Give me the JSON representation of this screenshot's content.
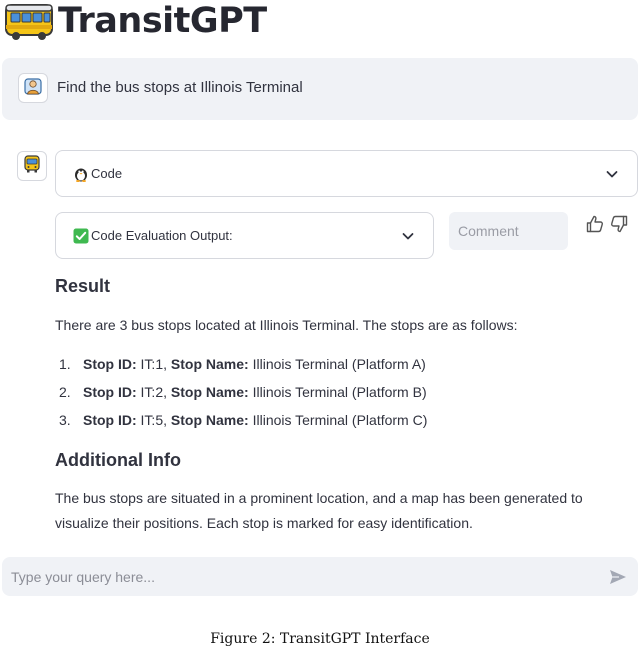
{
  "app": {
    "title": "TransitGPT",
    "logo_icon": "bus-icon"
  },
  "user_message": {
    "avatar_icon": "person-avatar-icon",
    "text": "Find the bus stops at Illinois Terminal"
  },
  "assistant": {
    "avatar_icon": "bus-avatar-icon",
    "code_expander": {
      "icon": "penguin-icon",
      "label": "Code",
      "expanded": false
    },
    "eval_expander": {
      "icon": "check-mark-icon",
      "label": "Code Evaluation Output:",
      "expanded": false
    },
    "comment": {
      "placeholder": "Comment",
      "value": ""
    },
    "feedback": {
      "thumbs_up_icon": "thumbs-up-icon",
      "thumbs_down_icon": "thumbs-down-icon"
    },
    "result_heading": "Result",
    "result_intro": "There are 3 bus stops located at Illinois Terminal. The stops are as follows:",
    "stop_id_label": "Stop ID:",
    "stop_name_label": "Stop Name:",
    "stops": [
      {
        "number": "1.",
        "id": "IT:1",
        "name": "Illinois Terminal (Platform A)"
      },
      {
        "number": "2.",
        "id": "IT:2",
        "name": "Illinois Terminal (Platform B)"
      },
      {
        "number": "3.",
        "id": "IT:5",
        "name": "Illinois Terminal (Platform C)"
      }
    ],
    "additional_heading": "Additional Info",
    "additional_text": "The bus stops are situated in a prominent location, and a map has been generated to visualize their positions. Each stop is marked for easy identification."
  },
  "chat_input": {
    "placeholder": "Type your query here...",
    "value": "",
    "send_icon": "send-icon"
  },
  "caption": "Figure 2: TransitGPT Interface",
  "colors": {
    "panel_bg": "#f0f2f6",
    "border": "#d6d8de",
    "text": "#31333f",
    "bus_yellow": "#f5c518",
    "bus_blue": "#4a90d9",
    "check_green": "#3fb950"
  }
}
